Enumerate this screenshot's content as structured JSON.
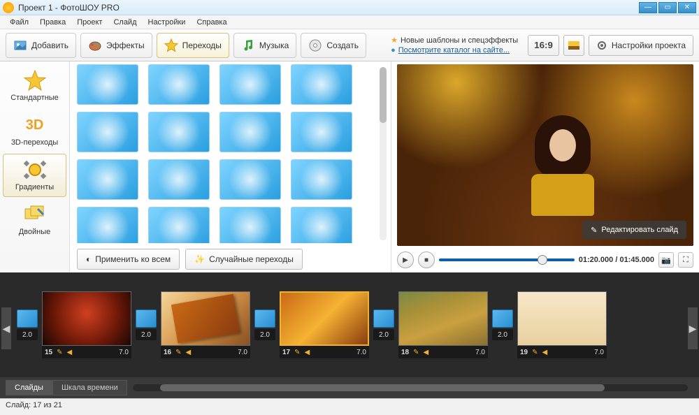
{
  "window": {
    "title": "Проект 1 - ФотоШОУ PRO"
  },
  "menu": [
    "Файл",
    "Правка",
    "Проект",
    "Слайд",
    "Настройки",
    "Справка"
  ],
  "nav": {
    "add": "Добавить",
    "effects": "Эффекты",
    "transitions": "Переходы",
    "music": "Музыка",
    "create": "Создать"
  },
  "promo": {
    "line1": "Новые шаблоны и спецэффекты",
    "line2": "Посмотрите каталог на сайте..."
  },
  "aspect": "16:9",
  "project_settings": "Настройки проекта",
  "categories": {
    "standard": "Стандартные",
    "threeD": "3D-переходы",
    "gradients": "Градиенты",
    "double": "Двойные"
  },
  "grid_actions": {
    "apply_all": "Применить ко всем",
    "random": "Случайные переходы"
  },
  "preview": {
    "edit_slide": "Редактировать слайд",
    "time": "01:20.000 / 01:45.000"
  },
  "timeline": {
    "transitions_duration": "2.0",
    "slides": [
      {
        "num": "15",
        "dur": "7.0"
      },
      {
        "num": "16",
        "dur": "7.0"
      },
      {
        "num": "17",
        "dur": "7.0"
      },
      {
        "num": "18",
        "dur": "7.0"
      },
      {
        "num": "19",
        "dur": "7.0"
      }
    ]
  },
  "bottom_tabs": {
    "slides": "Слайды",
    "timescale": "Шкала времени"
  },
  "status": "Слайд: 17 из 21"
}
